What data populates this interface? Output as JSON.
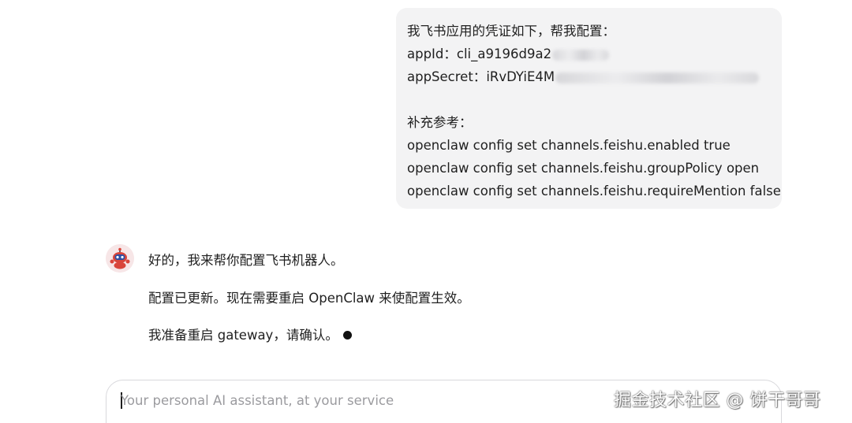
{
  "user_message": {
    "line1": "我飞书应用的凭证如下，帮我配置：",
    "app_id_label": "appId：",
    "app_id_value": "cli_a9196d9a2",
    "app_secret_label": "appSecret：",
    "app_secret_value": "iRvDYiE4M",
    "supplement_label": "补充参考：",
    "commands": [
      "openclaw config set channels.feishu.enabled true",
      "openclaw config set channels.feishu.groupPolicy open",
      "openclaw config set channels.feishu.requireMention false"
    ]
  },
  "assistant_message": {
    "line1": "好的，我来帮你配置飞书机器人。",
    "line2": "配置已更新。现在需要重启 OpenClaw 来使配置生效。",
    "line3": "我准备重启 gateway，请确认。"
  },
  "chat_input": {
    "placeholder": "Your personal AI assistant, at your service"
  },
  "watermark": "掘金技术社区 @ 饼干哥哥",
  "colors": {
    "bubble_bg": "#f3f3f4",
    "text": "#1f1f1f",
    "placeholder": "#9b9b9f",
    "avatar_red": "#d9453b",
    "avatar_blue": "#2f4fa3"
  },
  "icons": {
    "avatar": "robot-avatar-icon",
    "streaming": "streaming-dot-icon"
  }
}
